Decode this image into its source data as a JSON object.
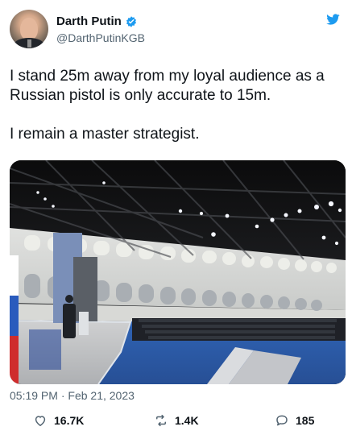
{
  "app": {
    "title": "Tweet"
  },
  "tweet": {
    "author": {
      "display_name": "Darth Putin",
      "handle": "@DarthPutinKGB",
      "verified": true
    },
    "text": "I stand 25m away from my loyal audience as a Russian pistol is only accurate to 15m.\n\nI remain a master strategist.",
    "meta": {
      "time": "05:19 PM",
      "separator": "·",
      "date": "Feb 21, 2023"
    },
    "stats": {
      "likes": "16.7K",
      "retweets": "1.4K",
      "replies": "185"
    }
  },
  "colors": {
    "text_primary": "#0f1419",
    "text_secondary": "#536471",
    "brand": "#1d9bf0",
    "background": "#ffffff"
  },
  "icons": {
    "verified": "verified-icon",
    "brand": "twitter-icon",
    "like": "heart-icon",
    "retweet": "retweet-icon",
    "reply": "reply-icon"
  }
}
